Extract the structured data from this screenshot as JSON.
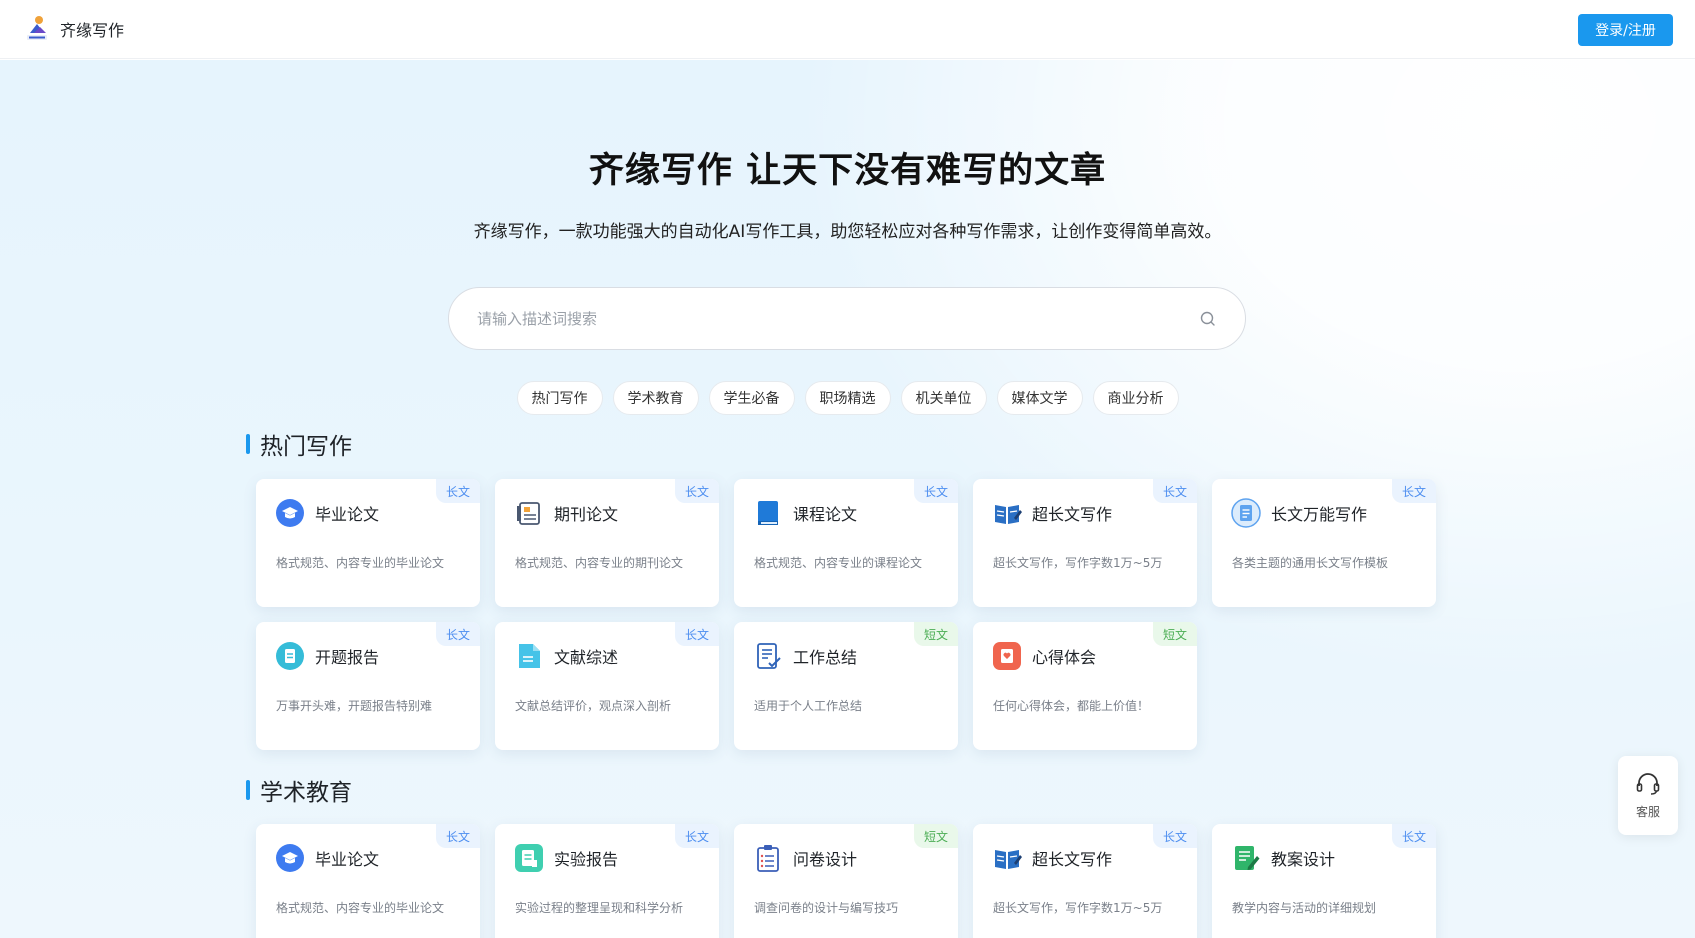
{
  "header": {
    "brand": "齐缘写作",
    "login_label": "登录/注册"
  },
  "hero": {
    "title": "齐缘写作 让天下没有难写的文章",
    "subtitle": "齐缘写作，一款功能强大的自动化AI写作工具，助您轻松应对各种写作需求，让创作变得简单高效。",
    "search_placeholder": "请输入描述词搜索"
  },
  "chips": [
    "热门写作",
    "学术教育",
    "学生必备",
    "职场精选",
    "机关单位",
    "媒体文学",
    "商业分析"
  ],
  "sections": [
    {
      "title": "热门写作",
      "cards": [
        {
          "name": "毕业论文",
          "desc": "格式规范、内容专业的毕业论文",
          "tag": "长文",
          "icon": "graduation-cap-icon"
        },
        {
          "name": "期刊论文",
          "desc": "格式规范、内容专业的期刊论文",
          "tag": "长文",
          "icon": "journal-icon"
        },
        {
          "name": "课程论文",
          "desc": "格式规范、内容专业的课程论文",
          "tag": "长文",
          "icon": "book-icon"
        },
        {
          "name": "超长文写作",
          "desc": "超长文写作，写作字数1万~5万",
          "tag": "长文",
          "icon": "open-book-pen-icon"
        },
        {
          "name": "长文万能写作",
          "desc": "各类主题的通用长文写作模板",
          "tag": "长文",
          "icon": "document-circle-icon"
        },
        {
          "name": "开题报告",
          "desc": "万事开头难，开题报告特别难",
          "tag": "长文",
          "icon": "report-icon"
        },
        {
          "name": "文献综述",
          "desc": "文献总结评价，观点深入剖析",
          "tag": "长文",
          "icon": "file-icon"
        },
        {
          "name": "工作总结",
          "desc": "适用于个人工作总结",
          "tag": "短文",
          "icon": "checklist-icon"
        },
        {
          "name": "心得体会",
          "desc": "任何心得体会，都能上价值！",
          "tag": "短文",
          "icon": "heart-note-icon"
        }
      ]
    },
    {
      "title": "学术教育",
      "cards": [
        {
          "name": "毕业论文",
          "desc": "格式规范、内容专业的毕业论文",
          "tag": "长文",
          "icon": "graduation-cap-icon"
        },
        {
          "name": "实验报告",
          "desc": "实验过程的整理呈现和科学分析",
          "tag": "长文",
          "icon": "lab-report-icon"
        },
        {
          "name": "问卷设计",
          "desc": "调查问卷的设计与编写技巧",
          "tag": "短文",
          "icon": "clipboard-icon"
        },
        {
          "name": "超长文写作",
          "desc": "超长文写作，写作字数1万~5万",
          "tag": "长文",
          "icon": "open-book-pen-icon"
        },
        {
          "name": "教案设计",
          "desc": "教学内容与活动的详细规划",
          "tag": "长文",
          "icon": "lesson-plan-icon"
        }
      ]
    }
  ],
  "service_label": "客服",
  "colors": {
    "accent": "#1a98ee",
    "long_tag": "#4d8ef0",
    "short_tag": "#4cae55"
  }
}
